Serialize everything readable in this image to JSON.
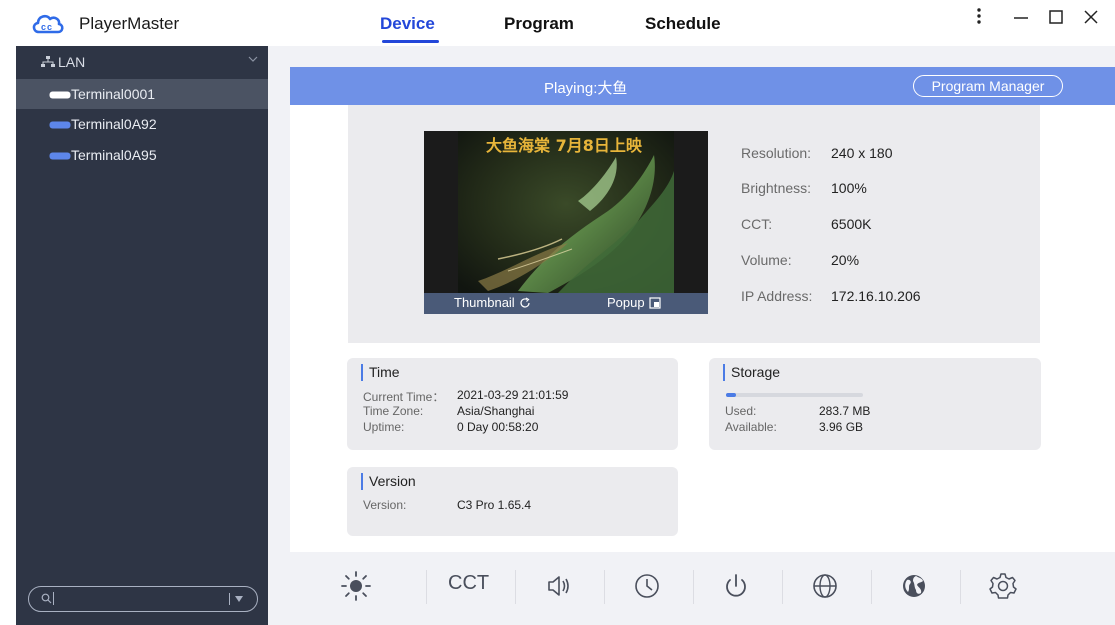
{
  "app": {
    "name": "PlayerMaster",
    "accent_color": "#2347d9"
  },
  "nav": {
    "tabs": [
      {
        "label": "Device",
        "active": true
      },
      {
        "label": "Program",
        "active": false
      },
      {
        "label": "Schedule",
        "active": false
      }
    ]
  },
  "window_controls": {
    "more": "more-icon",
    "minimize": "minimize-icon",
    "maximize": "maximize-icon",
    "close": "close-icon"
  },
  "sidebar": {
    "group": {
      "label": "LAN",
      "icon": "network-icon",
      "expanded": true
    },
    "terminals": [
      {
        "label": "Terminal0001",
        "selected": true
      },
      {
        "label": "Terminal0A92",
        "selected": false
      },
      {
        "label": "Terminal0A95",
        "selected": false
      }
    ],
    "search": {
      "value": "",
      "icon": "search-icon"
    },
    "background_color": "#2e3545"
  },
  "playing": {
    "label": "Playing:",
    "program": "大鱼",
    "button": "Program Manager",
    "bar_color": "#6f91e7"
  },
  "preview": {
    "thumbnail_label": "Thumbnail",
    "popup_label": "Popup",
    "banner_text": "大鱼海棠 7月8日上映"
  },
  "device_info": {
    "resolution": {
      "label": "Resolution:",
      "value": "240 x 180"
    },
    "brightness": {
      "label": "Brightness:",
      "value": "100%"
    },
    "cct": {
      "label": "CCT:",
      "value": "6500K"
    },
    "volume": {
      "label": "Volume:",
      "value": "20%"
    },
    "ip": {
      "label": "IP Address:",
      "value": "172.16.10.206"
    }
  },
  "time_card": {
    "title": "Time",
    "current_time": {
      "label": "Current Time：",
      "value": "2021-03-29 21:01:59"
    },
    "time_zone": {
      "label": "Time Zone:",
      "value": "Asia/Shanghai"
    },
    "uptime": {
      "label": "Uptime:",
      "value": "0 Day 00:58:20"
    }
  },
  "storage_card": {
    "title": "Storage",
    "used": {
      "label": "Used:",
      "value": "283.7 MB"
    },
    "available": {
      "label": "Available:",
      "value": "3.96 GB"
    },
    "used_fraction": 0.07
  },
  "version_card": {
    "title": "Version",
    "version": {
      "label": "Version:",
      "value": "C3 Pro 1.65.4"
    }
  },
  "toolbar": {
    "cct_label": "CCT",
    "icons": [
      "brightness-icon",
      "cct-button",
      "volume-icon",
      "clock-icon",
      "power-icon",
      "network-globe-icon",
      "earth-icon",
      "settings-icon"
    ]
  }
}
